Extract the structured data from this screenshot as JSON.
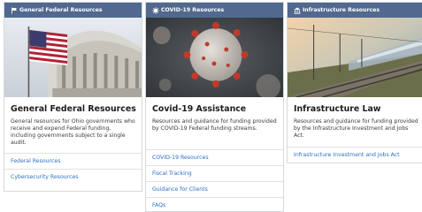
{
  "cards": [
    {
      "header": "General Federal Resources",
      "header_icon": "flag-icon",
      "image": "us-capitol-flag-photo",
      "title": "General Federal Resources",
      "description": "General resources for Ohio governments who receive and expend Federal funding, including governments subject to a single audit.",
      "links": [
        "Federal Resources",
        "Cybersecurity Resources"
      ]
    },
    {
      "header": "COVID-19 Resources",
      "header_icon": "virus-icon",
      "image": "coronavirus-photo",
      "title": "Covid-19 Assistance",
      "description": "Resources and guidance for funding provided by COVID-19 Federal funding streams.",
      "links": [
        "COVID-19 Resources",
        "Fiscal Tracking",
        "Guidance for Clients",
        "FAQs"
      ]
    },
    {
      "header": "Infrastructure Resources",
      "header_icon": "building-icon",
      "image": "train-rail-photo",
      "title": "Infrastructure Law",
      "description": "Resources and guidance for funding provided by the Infrastructure Investment and Jobs Act.",
      "links": [
        "Infrastructure Investment and Jobs Act"
      ]
    }
  ],
  "colors": {
    "header_bg": "#51698f",
    "link": "#2f6fc6",
    "border": "#d6d9de"
  }
}
